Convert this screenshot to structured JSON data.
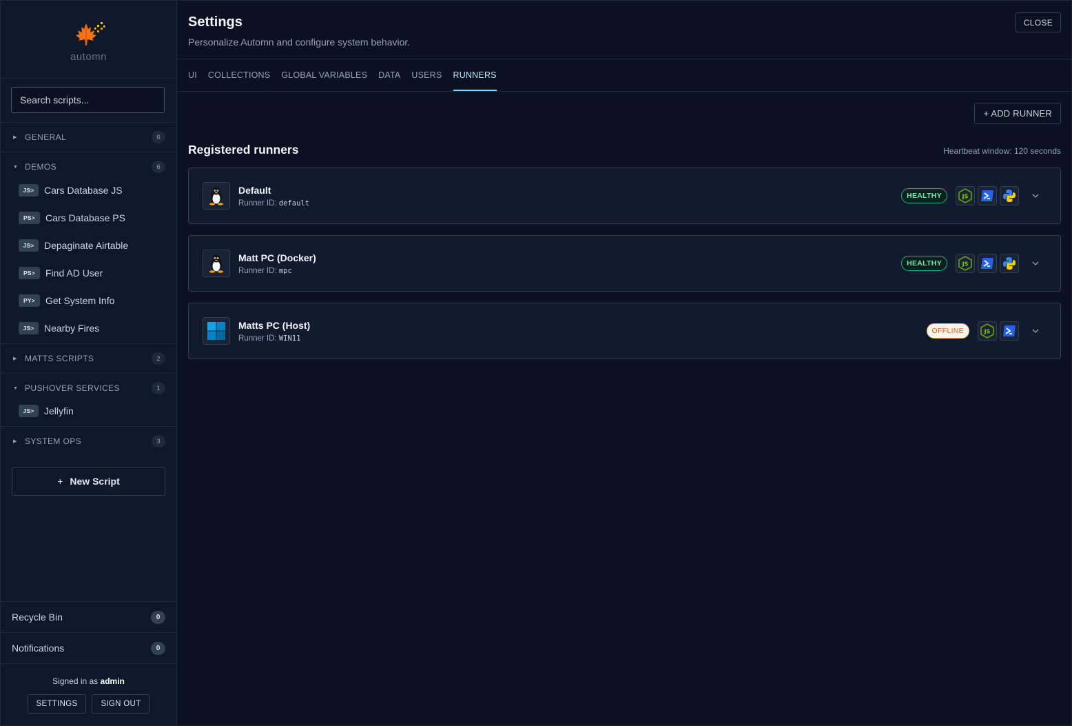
{
  "app": {
    "logo_text": "automn"
  },
  "sidebar": {
    "search_placeholder": "Search scripts...",
    "groups": [
      {
        "title": "GENERAL",
        "count": "6",
        "expanded": false
      },
      {
        "title": "DEMOS",
        "count": "6",
        "expanded": true,
        "scripts": [
          {
            "tag": "JS>",
            "name": "Cars Database JS"
          },
          {
            "tag": "PS>",
            "name": "Cars Database PS"
          },
          {
            "tag": "JS>",
            "name": "Depaginate Airtable"
          },
          {
            "tag": "PS>",
            "name": "Find AD User"
          },
          {
            "tag": "PY>",
            "name": "Get System Info"
          },
          {
            "tag": "JS>",
            "name": "Nearby Fires"
          }
        ]
      },
      {
        "title": "MATTS SCRIPTS",
        "count": "2",
        "expanded": false
      },
      {
        "title": "PUSHOVER SERVICES",
        "count": "1",
        "expanded": true,
        "scripts": [
          {
            "tag": "JS>",
            "name": "Jellyfin"
          }
        ]
      },
      {
        "title": "SYSTEM OPS",
        "count": "3",
        "expanded": false
      }
    ],
    "new_script_label": "New Script",
    "recycle_bin": {
      "label": "Recycle Bin",
      "count": "0"
    },
    "notifications": {
      "label": "Notifications",
      "count": "0"
    },
    "signed_in_prefix": "Signed in as",
    "signed_in_user": "admin",
    "settings_label": "SETTINGS",
    "sign_out_label": "SIGN OUT"
  },
  "settings": {
    "title": "Settings",
    "subtitle": "Personalize Automn and configure system behavior.",
    "close_label": "CLOSE",
    "tabs": [
      {
        "label": "UI",
        "active": false
      },
      {
        "label": "COLLECTIONS",
        "active": false
      },
      {
        "label": "GLOBAL VARIABLES",
        "active": false
      },
      {
        "label": "DATA",
        "active": false
      },
      {
        "label": "USERS",
        "active": false
      },
      {
        "label": "RUNNERS",
        "active": true
      }
    ],
    "add_runner_label": "+ ADD RUNNER",
    "section_title": "Registered runners",
    "heartbeat": "Heartbeat window: 120 seconds",
    "runner_id_prefix": "Runner ID:",
    "runners": [
      {
        "name": "Default",
        "id": "default",
        "os_icon": "linux-icon",
        "status": "HEALTHY",
        "status_color": "#10b981",
        "languages": [
          "nodejs-icon",
          "powershell-icon",
          "python-icon"
        ]
      },
      {
        "name": "Matt PC (Docker)",
        "id": "mpc",
        "os_icon": "linux-icon",
        "status": "HEALTHY",
        "status_color": "#10b981",
        "languages": [
          "nodejs-icon",
          "powershell-icon",
          "python-icon"
        ]
      },
      {
        "name": "Matts PC (Host)",
        "id": "WIN11",
        "os_icon": "windows-icon",
        "status": "OFFLINE",
        "status_color": "#ea580c",
        "languages": [
          "nodejs-icon",
          "powershell-icon"
        ]
      }
    ]
  },
  "colors": {
    "accent": "#7dd3fc",
    "healthy": "#10b981",
    "offline": "#ea580c",
    "bg": "#0b1120",
    "sidebar_bg": "#0f172a"
  }
}
